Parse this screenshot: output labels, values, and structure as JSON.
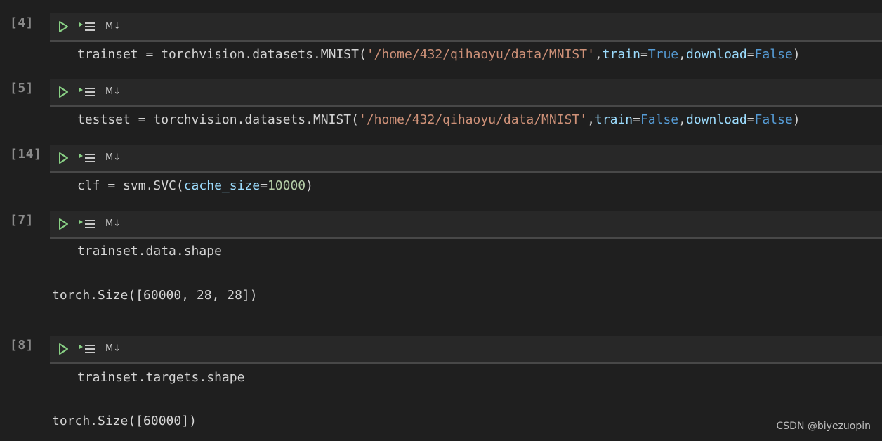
{
  "cells": [
    {
      "count": "[4]",
      "md_label": "M↓",
      "code": {
        "prefix": "trainset = torchvision.datasets.MNIST(",
        "str": "'/home/432/qihaoyu/data/MNIST'",
        "sep1": ",",
        "kw1": "train",
        "eq1": "=",
        "val1": "True",
        "sep2": ",",
        "kw2": "download",
        "eq2": "=",
        "val2": "False",
        "close": ")"
      }
    },
    {
      "count": "[5]",
      "md_label": "M↓",
      "code": {
        "prefix": "testset = torchvision.datasets.MNIST(",
        "str": "'/home/432/qihaoyu/data/MNIST'",
        "sep1": ",",
        "kw1": "train",
        "eq1": "=",
        "val1": "False",
        "sep2": ",",
        "kw2": "download",
        "eq2": "=",
        "val2": "False",
        "close": ")"
      }
    },
    {
      "count": "[14]",
      "md_label": "M↓",
      "code": {
        "prefix": "clf = svm.SVC(",
        "kw1": "cache_size",
        "eq1": "=",
        "val1": "10000",
        "close": ")"
      }
    },
    {
      "count": "[7]",
      "md_label": "M↓",
      "code": "trainset.data.shape",
      "output": "torch.Size([60000, 28, 28])"
    },
    {
      "count": "[8]",
      "md_label": "M↓",
      "code": "trainset.targets.shape",
      "output": "torch.Size([60000])"
    }
  ],
  "watermark": "CSDN @biyezuopin",
  "icons": {
    "run": "run-cell-icon",
    "run_below": "run-below-icon"
  },
  "colors": {
    "string": "#ce9178",
    "keyword_arg": "#9cdcfe",
    "boolean": "#569cd6",
    "number": "#b5cea8",
    "run_icon": "#89d185"
  }
}
